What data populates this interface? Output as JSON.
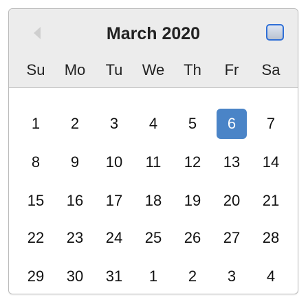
{
  "header": {
    "title": "March 2020",
    "prev_icon": "chevron-left-icon",
    "next_icon": "chevron-right-icon"
  },
  "weekdays": [
    "Su",
    "Mo",
    "Tu",
    "We",
    "Th",
    "Fr",
    "Sa"
  ],
  "weeks": [
    [
      "1",
      "2",
      "3",
      "4",
      "5",
      "6",
      "7"
    ],
    [
      "8",
      "9",
      "10",
      "11",
      "12",
      "13",
      "14"
    ],
    [
      "15",
      "16",
      "17",
      "18",
      "19",
      "20",
      "21"
    ],
    [
      "22",
      "23",
      "24",
      "25",
      "26",
      "27",
      "28"
    ],
    [
      "29",
      "30",
      "31",
      "1",
      "2",
      "3",
      "4"
    ]
  ],
  "selected_day": "6",
  "colors": {
    "selected_bg": "#4a84c7",
    "header_bg": "#ececec",
    "text": "#222222",
    "accent": "#2f6fd6"
  }
}
